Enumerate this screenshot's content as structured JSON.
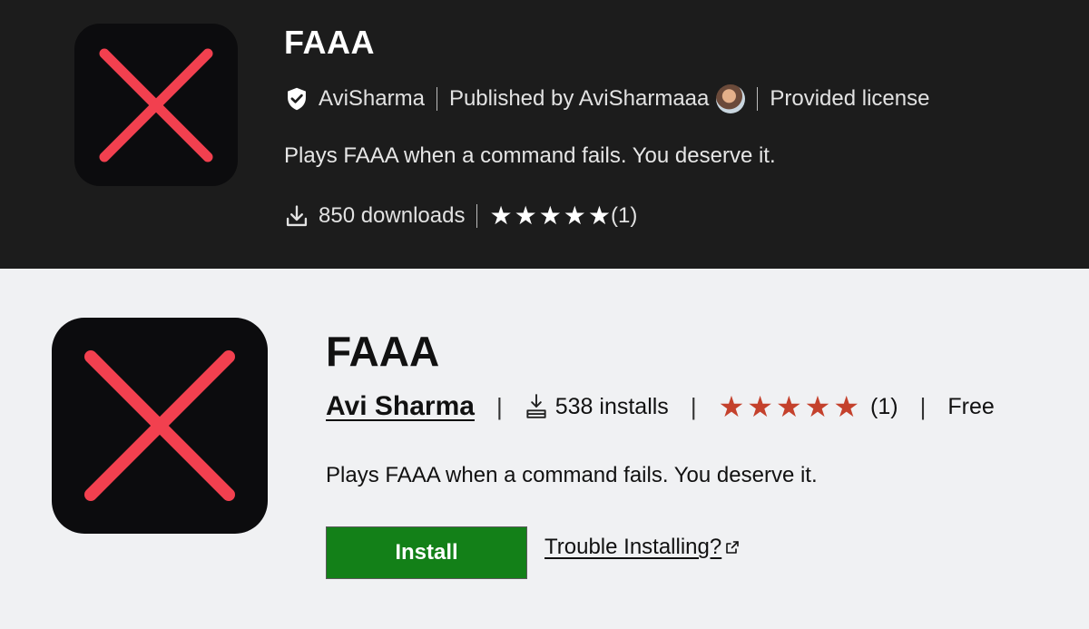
{
  "colors": {
    "dark_bg": "#1c1c1c",
    "light_bg": "#f0f1f3",
    "icon_bg": "#0c0c0e",
    "icon_cross": "#f2404f",
    "install_green": "#138018",
    "star_light": "#c4412c"
  },
  "dark_panel": {
    "title": "FAAA",
    "verified_icon": "shield-check-icon",
    "publisher_name": "AviSharma",
    "published_by": "Published by AviSharmaaa",
    "license": "Provided license",
    "description": "Plays FAAA when a command fails. You deserve it.",
    "download_icon": "download-icon",
    "downloads": "850 downloads",
    "rating_value": 5,
    "rating_max": 5,
    "rating_count": "(1)"
  },
  "light_panel": {
    "title": "FAAA",
    "publisher": "Avi Sharma",
    "separator": "|",
    "install_icon": "install-icon",
    "installs": "538 installs",
    "rating_value": 5,
    "rating_max": 5,
    "rating_count": "(1)",
    "price": "Free",
    "description": "Plays FAAA when a command fails. You deserve it.",
    "install_button": "Install",
    "trouble_link": "Trouble Installing?",
    "external_icon": "external-link-icon"
  }
}
